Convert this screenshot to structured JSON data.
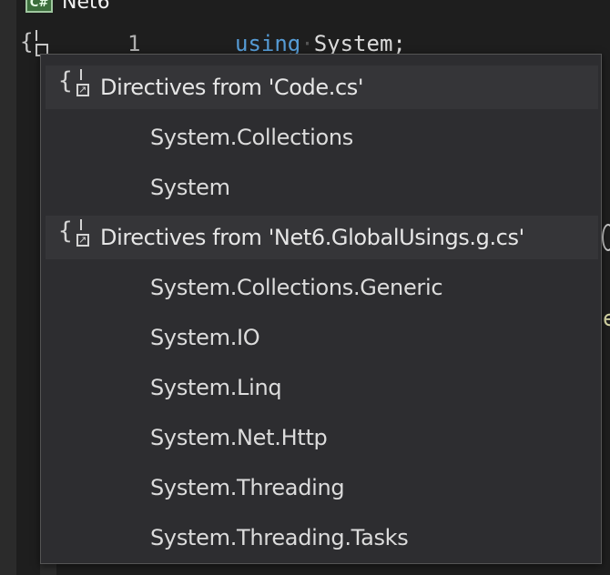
{
  "tab": {
    "icon": "csharp-file-icon",
    "icon_text": "C#",
    "label": "Net6"
  },
  "editor": {
    "gutter_icon": "using-directives-icon",
    "line_number": "1",
    "code_keyword": "using",
    "code_dot": "·",
    "code_namespace": "System;"
  },
  "popup": {
    "groups": [
      {
        "icon": "directives-reference-icon",
        "header": "Directives from 'Code.cs'",
        "items": [
          "System.Collections",
          "System"
        ]
      },
      {
        "icon": "directives-reference-icon",
        "header": "Directives from 'Net6.GlobalUsings.g.cs'",
        "items": [
          "System.Collections.Generic",
          "System.IO",
          "System.Linq",
          "System.Net.Http",
          "System.Threading",
          "System.Threading.Tasks"
        ]
      }
    ]
  },
  "colors": {
    "background": "#1e1e1e",
    "popup_background": "#2d2d30",
    "header_background": "#353538",
    "keyword": "#569cd6",
    "text": "#dcdcdc"
  }
}
